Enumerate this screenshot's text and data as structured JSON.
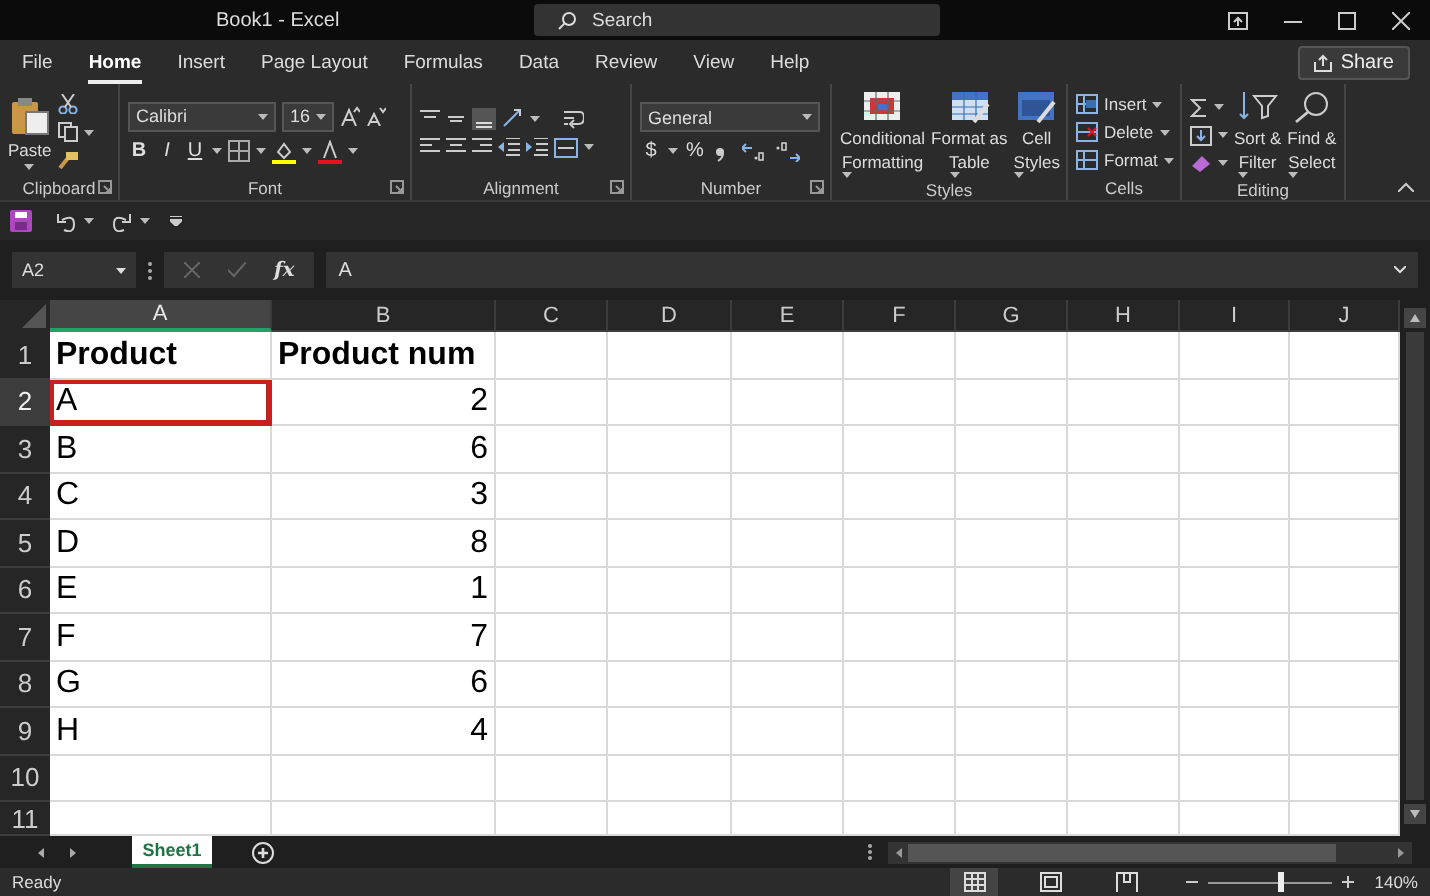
{
  "window": {
    "title": "Book1 - Excel"
  },
  "search": {
    "placeholder": "Search"
  },
  "menu_tabs": [
    {
      "label": "File",
      "selected": false
    },
    {
      "label": "Home",
      "selected": true
    },
    {
      "label": "Insert",
      "selected": false
    },
    {
      "label": "Page Layout",
      "selected": false
    },
    {
      "label": "Formulas",
      "selected": false
    },
    {
      "label": "Data",
      "selected": false
    },
    {
      "label": "Review",
      "selected": false
    },
    {
      "label": "View",
      "selected": false
    },
    {
      "label": "Help",
      "selected": false
    }
  ],
  "share_button": "Share",
  "ribbon_groups": [
    {
      "kind": "clipboard",
      "label": "Clipboard",
      "paste": "Paste"
    },
    {
      "kind": "font",
      "label": "Font",
      "font_name": "Calibri",
      "font_size": "16",
      "style_buttons": [
        "B",
        "I",
        "U"
      ]
    },
    {
      "kind": "alignment",
      "label": "Alignment"
    },
    {
      "kind": "number",
      "label": "Number",
      "format": "General",
      "symbol_buttons": [
        "$",
        "%"
      ]
    },
    {
      "kind": "styles",
      "label": "Styles",
      "buttons": [
        [
          "Conditional",
          "Formatting"
        ],
        [
          "Format as",
          "Table"
        ],
        [
          "Cell",
          "Styles"
        ]
      ]
    },
    {
      "kind": "cells",
      "label": "Cells",
      "buttons": [
        "Insert",
        "Delete",
        "Format"
      ]
    },
    {
      "kind": "editing",
      "label": "Editing",
      "buttons": [
        [
          "Sort &",
          "Filter"
        ],
        [
          "Find &",
          "Select"
        ]
      ]
    }
  ],
  "formula_bar": {
    "name_box": "A2",
    "function_button": "fx",
    "value": "A"
  },
  "columns": [
    {
      "label": "A",
      "selected": true
    },
    {
      "label": "B",
      "selected": false
    },
    {
      "label": "C",
      "selected": false
    },
    {
      "label": "D",
      "selected": false
    },
    {
      "label": "E",
      "selected": false
    },
    {
      "label": "F",
      "selected": false
    },
    {
      "label": "G",
      "selected": false
    },
    {
      "label": "H",
      "selected": false
    },
    {
      "label": "I",
      "selected": false
    },
    {
      "label": "J",
      "selected": false
    }
  ],
  "rows": [
    {
      "label": "1",
      "selected": false,
      "kind": "header",
      "cells": [
        {
          "text": "Product",
          "selected": false
        },
        {
          "text": "Product num",
          "selected": false
        }
      ]
    },
    {
      "label": "2",
      "selected": true,
      "kind": "data",
      "cells": [
        {
          "text": "A",
          "kind": "text",
          "selected": true
        },
        {
          "text": "2",
          "kind": "number",
          "selected": false
        }
      ]
    },
    {
      "label": "3",
      "selected": false,
      "kind": "data",
      "cells": [
        {
          "text": "B",
          "kind": "text",
          "selected": false
        },
        {
          "text": "6",
          "kind": "number",
          "selected": false
        }
      ]
    },
    {
      "label": "4",
      "selected": false,
      "kind": "data",
      "cells": [
        {
          "text": "C",
          "kind": "text",
          "selected": false
        },
        {
          "text": "3",
          "kind": "number",
          "selected": false
        }
      ]
    },
    {
      "label": "5",
      "selected": false,
      "kind": "data",
      "cells": [
        {
          "text": "D",
          "kind": "text",
          "selected": false
        },
        {
          "text": "8",
          "kind": "number",
          "selected": false
        }
      ]
    },
    {
      "label": "6",
      "selected": false,
      "kind": "data",
      "cells": [
        {
          "text": "E",
          "kind": "text",
          "selected": false
        },
        {
          "text": "1",
          "kind": "number",
          "selected": false
        }
      ]
    },
    {
      "label": "7",
      "selected": false,
      "kind": "data",
      "cells": [
        {
          "text": "F",
          "kind": "text",
          "selected": false
        },
        {
          "text": "7",
          "kind": "number",
          "selected": false
        }
      ]
    },
    {
      "label": "8",
      "selected": false,
      "kind": "data",
      "cells": [
        {
          "text": "G",
          "kind": "text",
          "selected": false
        },
        {
          "text": "6",
          "kind": "number",
          "selected": false
        }
      ]
    },
    {
      "label": "9",
      "selected": false,
      "kind": "data",
      "cells": [
        {
          "text": "H",
          "kind": "text",
          "selected": false
        },
        {
          "text": "4",
          "kind": "number",
          "selected": false
        }
      ]
    },
    {
      "label": "10",
      "selected": false,
      "cells": []
    },
    {
      "label": "11",
      "selected": false,
      "cells": []
    }
  ],
  "sheet_tabs": [
    {
      "label": "Sheet1",
      "selected": true
    }
  ],
  "status_bar": {
    "text": "Ready",
    "views": [
      {
        "kind": "normal",
        "selected": true
      },
      {
        "kind": "page_layout",
        "selected": false
      },
      {
        "kind": "page_break",
        "selected": false
      }
    ],
    "zoom_slider": {
      "level": 0.58
    },
    "zoom": "140%"
  }
}
